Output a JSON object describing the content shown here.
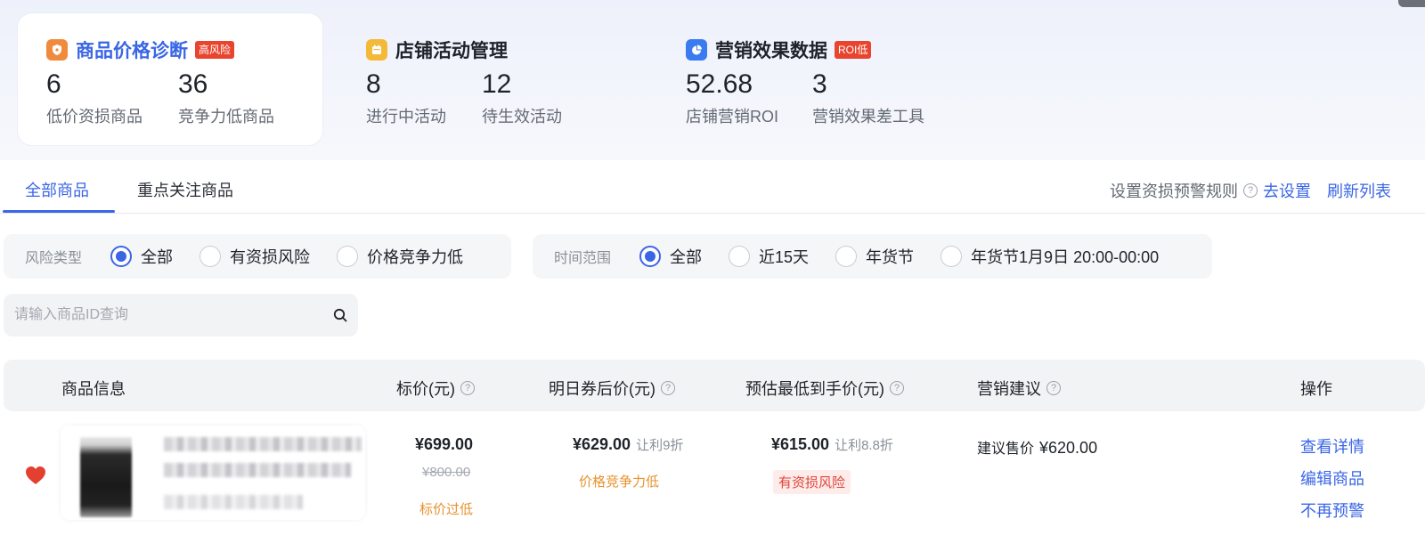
{
  "summary_cards": [
    {
      "title": "商品价格诊断",
      "tag": "高风险",
      "stats": [
        {
          "value": "6",
          "label": "低价资损商品"
        },
        {
          "value": "36",
          "label": "竞争力低商品"
        }
      ]
    },
    {
      "title": "店铺活动管理",
      "tag": "",
      "stats": [
        {
          "value": "8",
          "label": "进行中活动"
        },
        {
          "value": "12",
          "label": "待生效活动"
        }
      ]
    },
    {
      "title": "营销效果数据",
      "tag": "ROI低",
      "stats": [
        {
          "value": "52.68",
          "label": "店铺营销ROI"
        },
        {
          "value": "3",
          "label": "营销效果差工具"
        }
      ]
    }
  ],
  "tabs": [
    {
      "label": "全部商品"
    },
    {
      "label": "重点关注商品"
    }
  ],
  "tabs_right": {
    "rule_text": "设置资损预警规则",
    "set_link": "去设置",
    "refresh_link": "刷新列表"
  },
  "filters": {
    "risk": {
      "label": "风险类型",
      "options": [
        "全部",
        "有资损风险",
        "价格竞争力低"
      ],
      "selected": "全部"
    },
    "time": {
      "label": "时间范围",
      "options": [
        "全部",
        "近15天",
        "年货节",
        "年货节1月9日 20:00-00:00"
      ],
      "selected": "全部"
    }
  },
  "search": {
    "placeholder": "请输入商品ID查询",
    "value": ""
  },
  "table": {
    "columns": [
      "商品信息",
      "标价(元)",
      "明日券后价(元)",
      "预估最低到手价(元)",
      "营销建议",
      "操作"
    ],
    "rows": [
      {
        "list_price": "¥699.00",
        "original_price": "¥800.00",
        "list_price_warning": "标价过低",
        "tomorrow_price": "¥629.00",
        "tomorrow_discount": "让利9折",
        "tomorrow_warning": "价格竞争力低",
        "lowest_price": "¥615.00",
        "lowest_discount": "让利8.8折",
        "lowest_risk": "有资损风险",
        "suggest_label": "建议售价",
        "suggest_value": "¥620.00",
        "actions": [
          "查看详情",
          "编辑商品",
          "不再预警"
        ]
      }
    ]
  },
  "colors": {
    "accent": "#3a66e6",
    "danger": "#e8442e",
    "warning": "#e6932e"
  }
}
